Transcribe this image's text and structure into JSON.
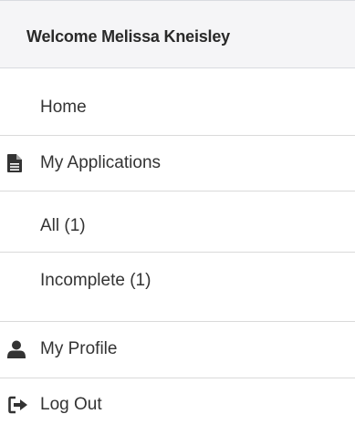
{
  "header": {
    "welcome_text": "Welcome Melissa Kneisley"
  },
  "nav": {
    "home": "Home",
    "my_applications": {
      "label": "My Applications",
      "icon": "file-icon"
    },
    "all": "All (1)",
    "incomplete": "Incomplete (1)",
    "my_profile": {
      "label": "My Profile",
      "icon": "user-icon"
    },
    "log_out": {
      "label": "Log Out",
      "icon": "sign-out-icon"
    }
  },
  "colors": {
    "header_bg": "#f5f5f7",
    "divider": "#dadada",
    "text": "#333333",
    "icon": "#333333"
  }
}
